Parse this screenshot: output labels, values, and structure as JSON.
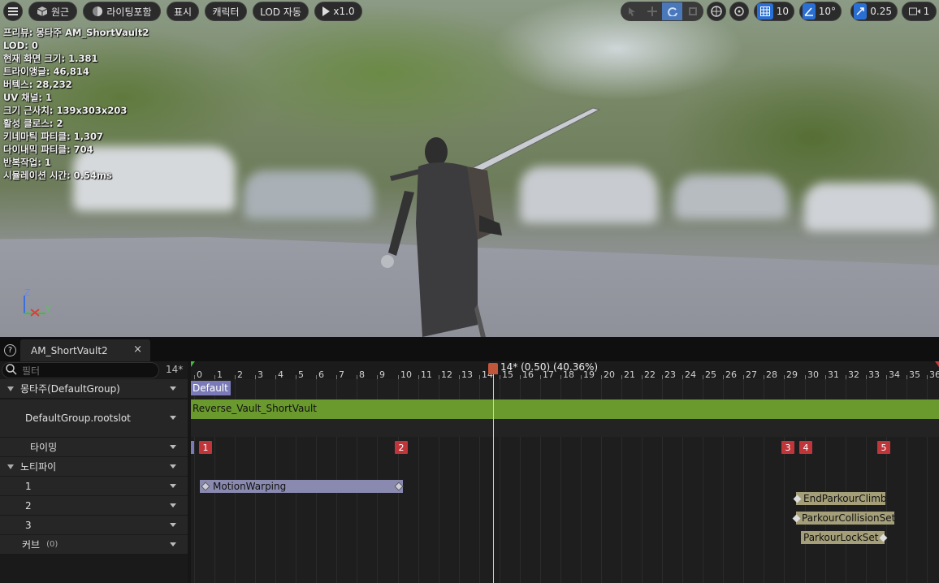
{
  "toolbar": {
    "menu_icon": "hamburger-icon",
    "perspective_label": "원근",
    "lighting_label": "라이팅포함",
    "show_label": "표시",
    "character_label": "캐릭터",
    "lod_label": "LOD 자동",
    "play_speed_label": "x1.0",
    "grid_value": "10",
    "angle_value": "10°",
    "scale_value": "0.25",
    "camera_value": "1",
    "accent_color": "#2a6fd3"
  },
  "stats": [
    "프리뷰: 몽타주 AM_ShortVault2",
    "LOD: 0",
    "현재 화면 크기: 1.381",
    "트라이앵글: 46,814",
    "버텍스: 28,232",
    "UV 채널: 1",
    "크기 근사치: 139x303x203",
    "활성 클로스: 2",
    "키네마틱 파티클: 1,307",
    "다이내믹 파티클: 704",
    "반복작업: 1",
    "시뮬레이션 시간: 0.54ms"
  ],
  "axis": {
    "z": "Z",
    "y": "Y"
  },
  "tab": {
    "title": "AM_ShortVault2",
    "close": "×",
    "help_icon": "question-icon"
  },
  "filter": {
    "placeholder": "필터",
    "frame_label": "14*"
  },
  "rows": {
    "montage": "몽타주(DefaultGroup)",
    "slot": "DefaultGroup.rootslot",
    "timing": "타이밍",
    "notifies": "노티파이",
    "track1": "1",
    "track2": "2",
    "track3": "3",
    "curves": "커브",
    "curves_count": "(0)"
  },
  "timeline": {
    "playhead_label": "14* (0.50) (40.36%)",
    "frames": [
      "0",
      "1",
      "2",
      "3",
      "4",
      "5",
      "6",
      "7",
      "8",
      "9",
      "10",
      "11",
      "12",
      "13",
      "14",
      "15",
      "16",
      "17",
      "18",
      "19",
      "20",
      "21",
      "22",
      "23",
      "24",
      "25",
      "26",
      "27",
      "28",
      "29",
      "30",
      "31",
      "32",
      "33",
      "34",
      "35",
      "36"
    ],
    "section_label": "Default",
    "segment_label": "Reverse_Vault_ShortVault",
    "segment_color": "#6a9a2e",
    "timing_markers": [
      "1",
      "2",
      "3",
      "4",
      "5"
    ],
    "notifies": {
      "motion_warping": "MotionWarping",
      "end_climb": "EndParkourClimb",
      "collision_set": "ParkourCollisionSet",
      "lock_set": "ParkourLockSet"
    },
    "marker_color": "#c0353a"
  }
}
